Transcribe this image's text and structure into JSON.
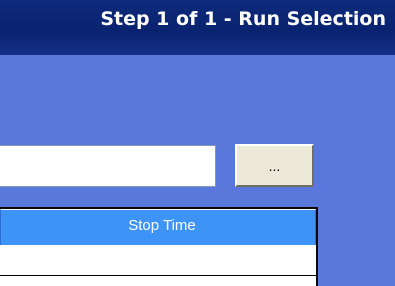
{
  "wizard": {
    "step_title": "Step 1 of 1 - Run Selection"
  },
  "run_path": {
    "value": "",
    "placeholder": ""
  },
  "browse_button": {
    "label": "..."
  },
  "run_table": {
    "columns": [
      "Stop Time"
    ],
    "rows": [
      {
        "stop_time": ""
      }
    ]
  },
  "colors": {
    "background": "#5a78dc",
    "title_bar": "#0a2370",
    "header_accent": "#3d94f6"
  }
}
